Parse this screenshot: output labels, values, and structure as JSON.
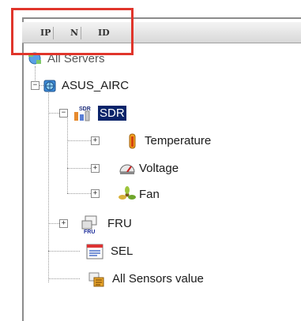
{
  "columns": {
    "ip": "IP",
    "n": "N",
    "id": "ID"
  },
  "tree": {
    "root": "All Servers",
    "server": "ASUS_AIRC",
    "sdr": {
      "label": "SDR",
      "icon_badge": "SDR",
      "children": [
        {
          "label": "Temperature",
          "icon": "thermometer-icon"
        },
        {
          "label": "Voltage",
          "icon": "voltage-gauge-icon"
        },
        {
          "label": "Fan",
          "icon": "fan-icon"
        }
      ]
    },
    "fru": {
      "label": "FRU",
      "icon_badge": "FRU"
    },
    "sel": {
      "label": "SEL"
    },
    "all_sensors": {
      "label": "All Sensors value"
    }
  },
  "colors": {
    "highlight": "#e0352b",
    "selected_bg": "#0a246a",
    "selected_fg": "#ffffff"
  }
}
